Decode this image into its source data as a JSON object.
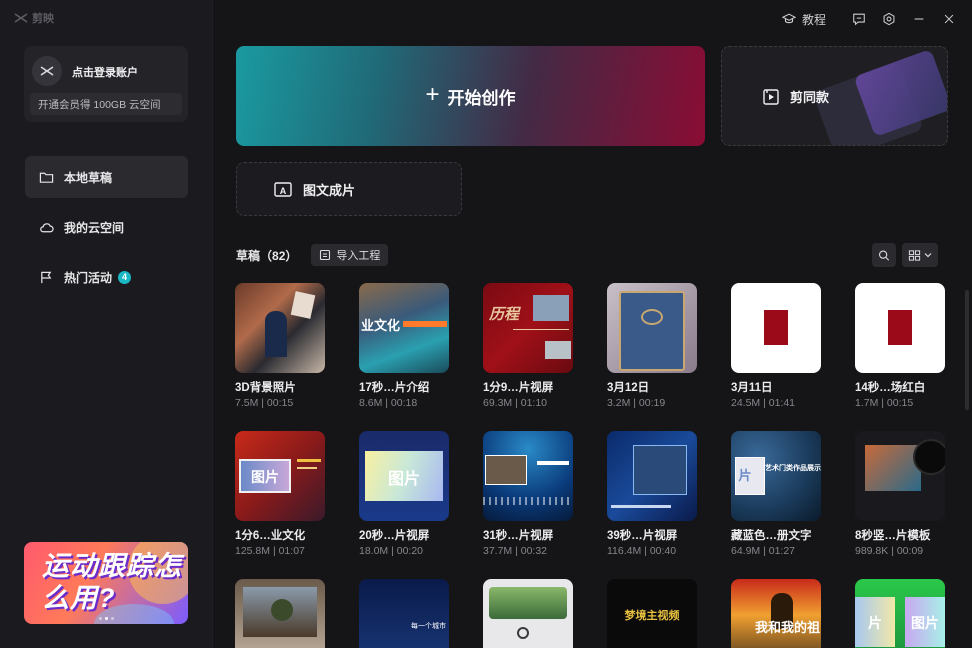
{
  "app": {
    "name": "剪映"
  },
  "titlebar": {
    "tutorial_label": "教程"
  },
  "sidebar": {
    "account": {
      "login_label": "点击登录账户",
      "vip_text": "开通会员得 100GB 云空间"
    },
    "nav": [
      {
        "label": "本地草稿",
        "icon": "folder-icon",
        "active": true
      },
      {
        "label": "我的云空间",
        "icon": "cloud-icon",
        "active": false
      },
      {
        "label": "热门活动",
        "icon": "flag-icon",
        "active": false,
        "badge": "4"
      }
    ],
    "promo": {
      "text": "运动跟踪怎么用?",
      "slides": 3,
      "current": 2
    }
  },
  "main": {
    "create_label": "开始创作",
    "template_label": "剪同款",
    "image_text_label": "图文成片",
    "drafts": {
      "title": "草稿",
      "count": "（82）",
      "import_label": "导入工程"
    }
  },
  "drafts": [
    {
      "title": "3D背景照片",
      "size": "7.5M",
      "duration": "00:15"
    },
    {
      "title": "17秒…片介绍",
      "size": "8.6M",
      "duration": "00:18"
    },
    {
      "title": "1分9…片视屏",
      "size": "69.3M",
      "duration": "01:10"
    },
    {
      "title": "3月12日",
      "size": "3.2M",
      "duration": "00:19"
    },
    {
      "title": "3月11日",
      "size": "24.5M",
      "duration": "01:41"
    },
    {
      "title": "14秒…场红白",
      "size": "1.7M",
      "duration": "00:15"
    },
    {
      "title": "1分6…业文化",
      "size": "125.8M",
      "duration": "01:07"
    },
    {
      "title": "20秒…片视屏",
      "size": "18.0M",
      "duration": "00:20"
    },
    {
      "title": "31秒…片视屏",
      "size": "37.7M",
      "duration": "00:32"
    },
    {
      "title": "39秒…片视屏",
      "size": "116.4M",
      "duration": "00:40"
    },
    {
      "title": "藏蓝色…册文字",
      "size": "64.9M",
      "duration": "01:27"
    },
    {
      "title": "8秒竖…片模板",
      "size": "989.8K",
      "duration": "00:09"
    },
    {
      "title": "",
      "size": "",
      "duration": ""
    },
    {
      "title": "",
      "size": "",
      "duration": ""
    },
    {
      "title": "",
      "size": "",
      "duration": ""
    },
    {
      "title": "",
      "size": "",
      "duration": ""
    },
    {
      "title": "",
      "size": "",
      "duration": ""
    },
    {
      "title": "",
      "size": "",
      "duration": ""
    }
  ],
  "thumb_text": {
    "t1": "业文化",
    "t2": "历程",
    "t6": "图片",
    "t7": "图片",
    "t10": "片",
    "t10b": "艺术门类作品展示",
    "t13": "每一个城市",
    "t15": "梦境主视频",
    "t16": "我和我的祖",
    "t17a": "片",
    "t17b": "图片"
  },
  "colors": {
    "accent": "#19b8c4",
    "brand_red": "#9b0a18"
  }
}
